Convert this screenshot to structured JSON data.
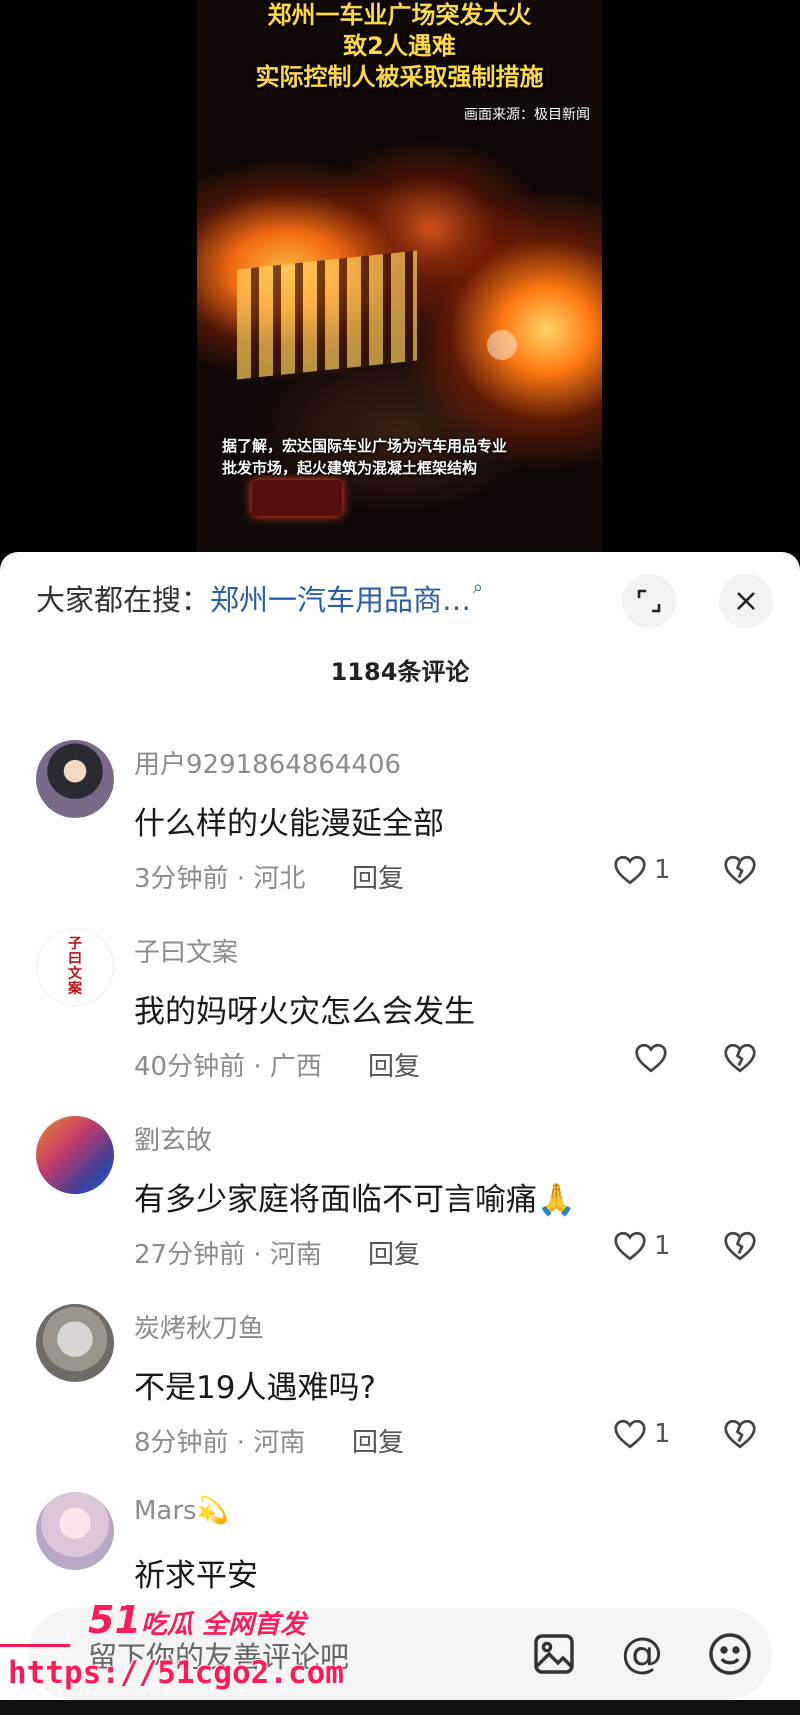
{
  "video": {
    "title_line1": "郑州一车业广场突发大火",
    "title_line2": "致2人遇难",
    "title_line3": "实际控制人被采取强制措施",
    "source": "画面来源：极目新闻",
    "caption_line1": "据了解，宏达国际车业广场为汽车用品专业",
    "caption_line2": "批发市场，起火建筑为混凝土框架结构"
  },
  "search": {
    "label": "大家都在搜：",
    "query": "郑州一汽车用品商…"
  },
  "comment_count": "1184条评论",
  "reply_label": "回复",
  "comments": [
    {
      "username": "用户9291864864406",
      "content": "什么样的火能漫延全部",
      "meta": "3分钟前 · 河北",
      "likes": "1"
    },
    {
      "username": "子曰文案",
      "avatar_text": "子曰文案",
      "content": "我的妈呀火灾怎么会发生",
      "meta": "40分钟前 · 广西",
      "likes": ""
    },
    {
      "username": "劉玄敀",
      "content": "有多少家庭将面临不可言喻痛🙏",
      "meta": "27分钟前 · 河南",
      "likes": "1"
    },
    {
      "username": "炭烤秋刀鱼",
      "content": "不是19人遇难吗?",
      "meta": "8分钟前 · 河南",
      "likes": "1"
    },
    {
      "username": "Mars💫",
      "content": "祈求平安"
    }
  ],
  "input": {
    "placeholder": "留下你的友善评论吧"
  },
  "watermark": {
    "brand_num": "51",
    "brand_text": "吃瓜 全网首发",
    "url": "https://51cgo2.com"
  },
  "icons": {
    "expand": "expand-icon",
    "close": "close-icon",
    "search": "search-icon",
    "like": "heart-icon",
    "dislike": "broken-heart-icon",
    "image": "image-icon",
    "at": "at-icon",
    "emoji": "emoji-icon"
  },
  "colors": {
    "link": "#2a5fa8",
    "watermark": "#ff1a5a",
    "title_yellow": "#ffd84a"
  }
}
